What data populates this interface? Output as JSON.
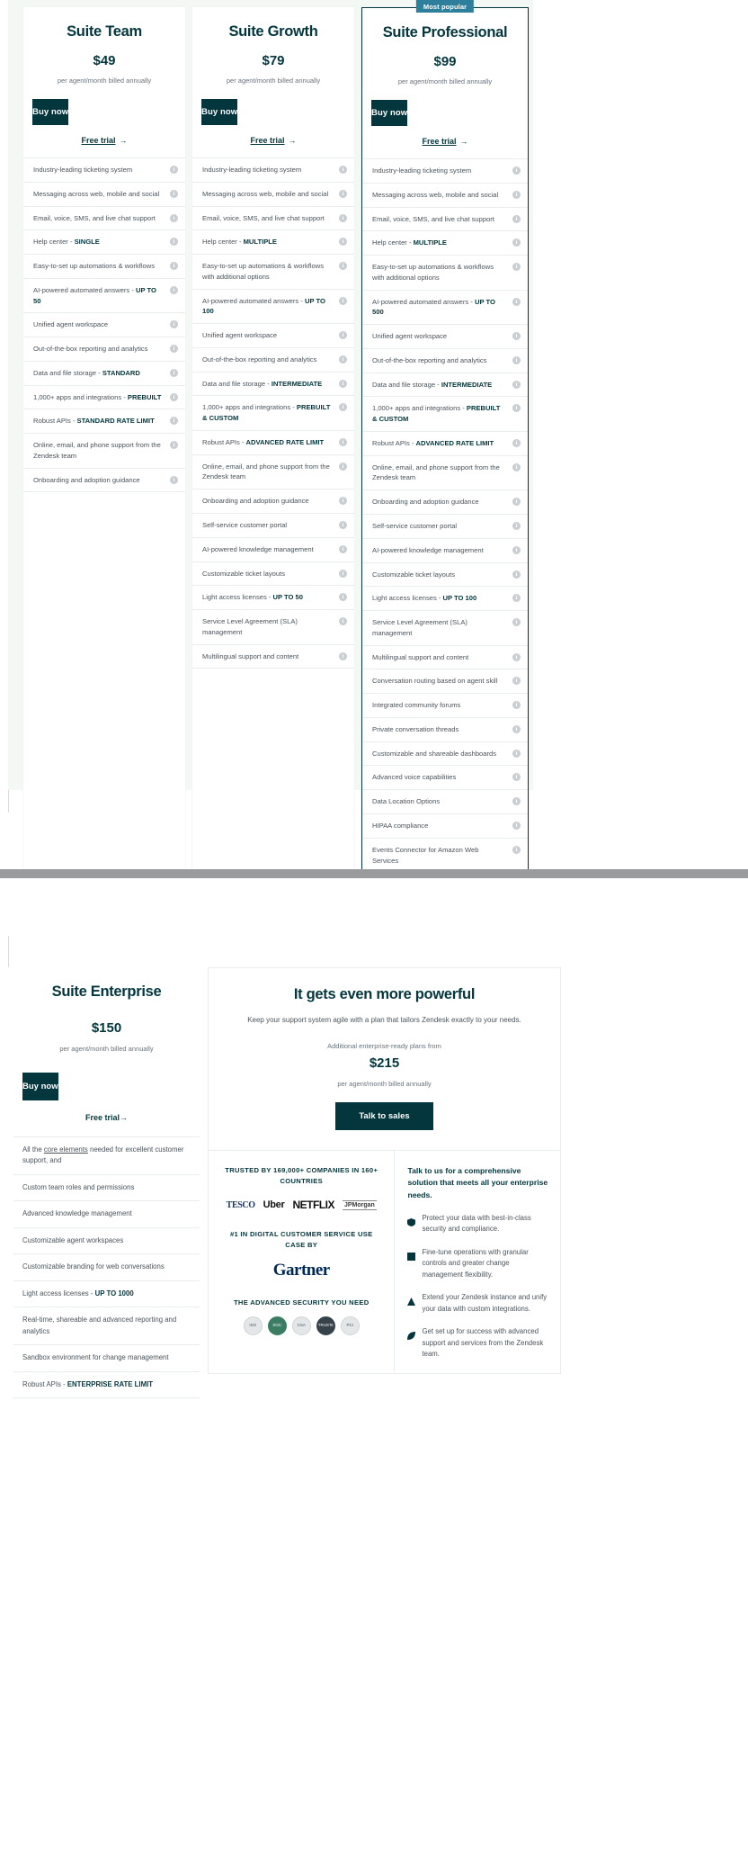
{
  "top": {
    "plans": [
      {
        "name": "Suite Team",
        "price": "$49",
        "note": "per agent/month billed annually",
        "buy_label": "Buy now",
        "trial_label": "Free trial",
        "trial_arrow": "→",
        "badge": "",
        "features": [
          {
            "text": "Industry-leading ticketing system",
            "strong": ""
          },
          {
            "text": "Messaging across web, mobile and social",
            "strong": ""
          },
          {
            "text": "Email, voice, SMS, and live chat support",
            "strong": ""
          },
          {
            "text": "Help center - ",
            "strong": "SINGLE"
          },
          {
            "text": "Easy-to-set up automations & workflows",
            "strong": ""
          },
          {
            "text": "AI-powered automated answers - ",
            "strong": "UP TO 50"
          },
          {
            "text": "Unified agent workspace",
            "strong": ""
          },
          {
            "text": "Out-of-the-box reporting and analytics",
            "strong": ""
          },
          {
            "text": "Data and file storage - ",
            "strong": "STANDARD"
          },
          {
            "text": "1,000+ apps and integrations - ",
            "strong": "PREBUILT"
          },
          {
            "text": "Robust APIs - ",
            "strong": "STANDARD RATE LIMIT"
          },
          {
            "text": "Online, email, and phone support from the Zendesk team",
            "strong": ""
          },
          {
            "text": "Onboarding and adoption guidance",
            "strong": ""
          }
        ]
      },
      {
        "name": "Suite Growth",
        "price": "$79",
        "note": "per agent/month billed annually",
        "buy_label": "Buy now",
        "trial_label": "Free trial",
        "trial_arrow": "→",
        "badge": "",
        "features": [
          {
            "text": "Industry-leading ticketing system",
            "strong": ""
          },
          {
            "text": "Messaging across web, mobile and social",
            "strong": ""
          },
          {
            "text": "Email, voice, SMS, and live chat support",
            "strong": ""
          },
          {
            "text": "Help center - ",
            "strong": "MULTIPLE"
          },
          {
            "text": "Easy-to-set up automations & workflows with additional options",
            "strong": ""
          },
          {
            "text": "AI-powered automated answers - ",
            "strong": "UP TO 100"
          },
          {
            "text": "Unified agent workspace",
            "strong": ""
          },
          {
            "text": "Out-of-the-box reporting and analytics",
            "strong": ""
          },
          {
            "text": "Data and file storage - ",
            "strong": "INTERMEDIATE"
          },
          {
            "text": "1,000+ apps and integrations - ",
            "strong": "PREBUILT & CUSTOM"
          },
          {
            "text": "Robust APIs - ",
            "strong": "ADVANCED RATE LIMIT"
          },
          {
            "text": "Online, email, and phone support from the Zendesk team",
            "strong": ""
          },
          {
            "text": "Onboarding and adoption guidance",
            "strong": ""
          },
          {
            "text": "Self-service customer portal",
            "strong": ""
          },
          {
            "text": "AI-powered knowledge management",
            "strong": ""
          },
          {
            "text": "Customizable ticket layouts",
            "strong": ""
          },
          {
            "text": "Light access licenses - ",
            "strong": "UP TO 50"
          },
          {
            "text": "Service Level Agreement (SLA) management",
            "strong": ""
          },
          {
            "text": "Multilingual support and content",
            "strong": ""
          }
        ]
      },
      {
        "name": "Suite Professional",
        "price": "$99",
        "note": "per agent/month billed annually",
        "buy_label": "Buy now",
        "trial_label": "Free trial",
        "trial_arrow": "→",
        "badge": "Most popular",
        "features": [
          {
            "text": "Industry-leading ticketing system",
            "strong": ""
          },
          {
            "text": "Messaging across web, mobile and social",
            "strong": ""
          },
          {
            "text": "Email, voice, SMS, and live chat support",
            "strong": ""
          },
          {
            "text": "Help center - ",
            "strong": "MULTIPLE"
          },
          {
            "text": "Easy-to-set up automations & workflows with additional options",
            "strong": ""
          },
          {
            "text": "AI-powered automated answers - ",
            "strong": "UP TO 500"
          },
          {
            "text": "Unified agent workspace",
            "strong": ""
          },
          {
            "text": "Out-of-the-box reporting and analytics",
            "strong": ""
          },
          {
            "text": "Data and file storage - ",
            "strong": "INTERMEDIATE"
          },
          {
            "text": "1,000+ apps and integrations - ",
            "strong": "PREBUILT & CUSTOM"
          },
          {
            "text": "Robust APIs - ",
            "strong": "ADVANCED RATE LIMIT"
          },
          {
            "text": "Online, email, and phone support from the Zendesk team",
            "strong": ""
          },
          {
            "text": "Onboarding and adoption guidance",
            "strong": ""
          },
          {
            "text": "Self-service customer portal",
            "strong": ""
          },
          {
            "text": "AI-powered knowledge management",
            "strong": ""
          },
          {
            "text": "Customizable ticket layouts",
            "strong": ""
          },
          {
            "text": "Light access licenses - ",
            "strong": "UP TO 100"
          },
          {
            "text": "Service Level Agreement (SLA) management",
            "strong": ""
          },
          {
            "text": "Multilingual support and content",
            "strong": ""
          },
          {
            "text": "Conversation routing based on agent skill",
            "strong": ""
          },
          {
            "text": "Integrated community forums",
            "strong": ""
          },
          {
            "text": "Private conversation threads",
            "strong": ""
          },
          {
            "text": "Customizable and shareable dashboards",
            "strong": ""
          },
          {
            "text": "Advanced voice capabilities",
            "strong": ""
          },
          {
            "text": "Data Location Options",
            "strong": ""
          },
          {
            "text": "HIPAA compliance",
            "strong": ""
          },
          {
            "text": "Events Connector for Amazon Web Services",
            "strong": ""
          }
        ]
      }
    ],
    "info_glyph": "i"
  },
  "bottom": {
    "enterprise": {
      "name": "Suite Enterprise",
      "price": "$150",
      "note": "per agent/month billed annually",
      "buy_label": "Buy now",
      "trial_label": "Free trial",
      "trial_arrow": "→",
      "features": [
        {
          "pre": "All the ",
          "link": "core elements",
          "post": " needed for excellent customer support, and"
        },
        {
          "pre": "Custom team roles and permissions",
          "link": "",
          "post": ""
        },
        {
          "pre": "Advanced knowledge management",
          "link": "",
          "post": ""
        },
        {
          "pre": "Customizable agent workspaces",
          "link": "",
          "post": ""
        },
        {
          "pre": "Customizable branding for web conversations",
          "link": "",
          "post": ""
        },
        {
          "pre": "Light access licenses - ",
          "link": "",
          "post": "",
          "strong": "UP TO 1000"
        },
        {
          "pre": "Real-time, shareable and advanced reporting and analytics",
          "link": "",
          "post": ""
        },
        {
          "pre": "Sandbox environment for change management",
          "link": "",
          "post": ""
        },
        {
          "pre": "Robust APIs - ",
          "link": "",
          "post": "",
          "strong": "ENTERPRISE RATE LIMIT"
        }
      ]
    },
    "powerful": {
      "title": "It gets even more powerful",
      "subtitle": "Keep your support system agile with a plan that tailors Zendesk exactly to your needs.",
      "from_label": "Additional enterprise-ready plans from",
      "price": "$215",
      "note": "per agent/month billed annually",
      "cta_label": "Talk to sales",
      "trust_head": "TRUSTED BY 169,000+ COMPANIES IN 160+ COUNTRIES",
      "logos": [
        "TESCO",
        "Uber",
        "NETFLIX",
        "JPMorgan"
      ],
      "gartner_head": "#1 IN DIGITAL CUSTOMER SERVICE USE CASE BY",
      "gartner_logo": "Gartner",
      "security_head": "THE ADVANCED SECURITY YOU NEED",
      "security_badges": [
        "ISO",
        "SOC",
        "CSA",
        "TRUSTe",
        "PCI"
      ],
      "right_title": "Talk to us for a comprehensive solution that meets all your enterprise needs.",
      "right_items": [
        {
          "glyph": "shield",
          "text": "Protect your data with best-in-class security and compliance."
        },
        {
          "glyph": "square",
          "text": "Fine-tune operations with granular controls and greater change management flexibility."
        },
        {
          "glyph": "triangle",
          "text": "Extend your Zendesk instance and unify your data with custom integrations."
        },
        {
          "glyph": "leaf",
          "text": "Get set up for success with advanced support and services from the Zendesk team."
        }
      ]
    }
  }
}
